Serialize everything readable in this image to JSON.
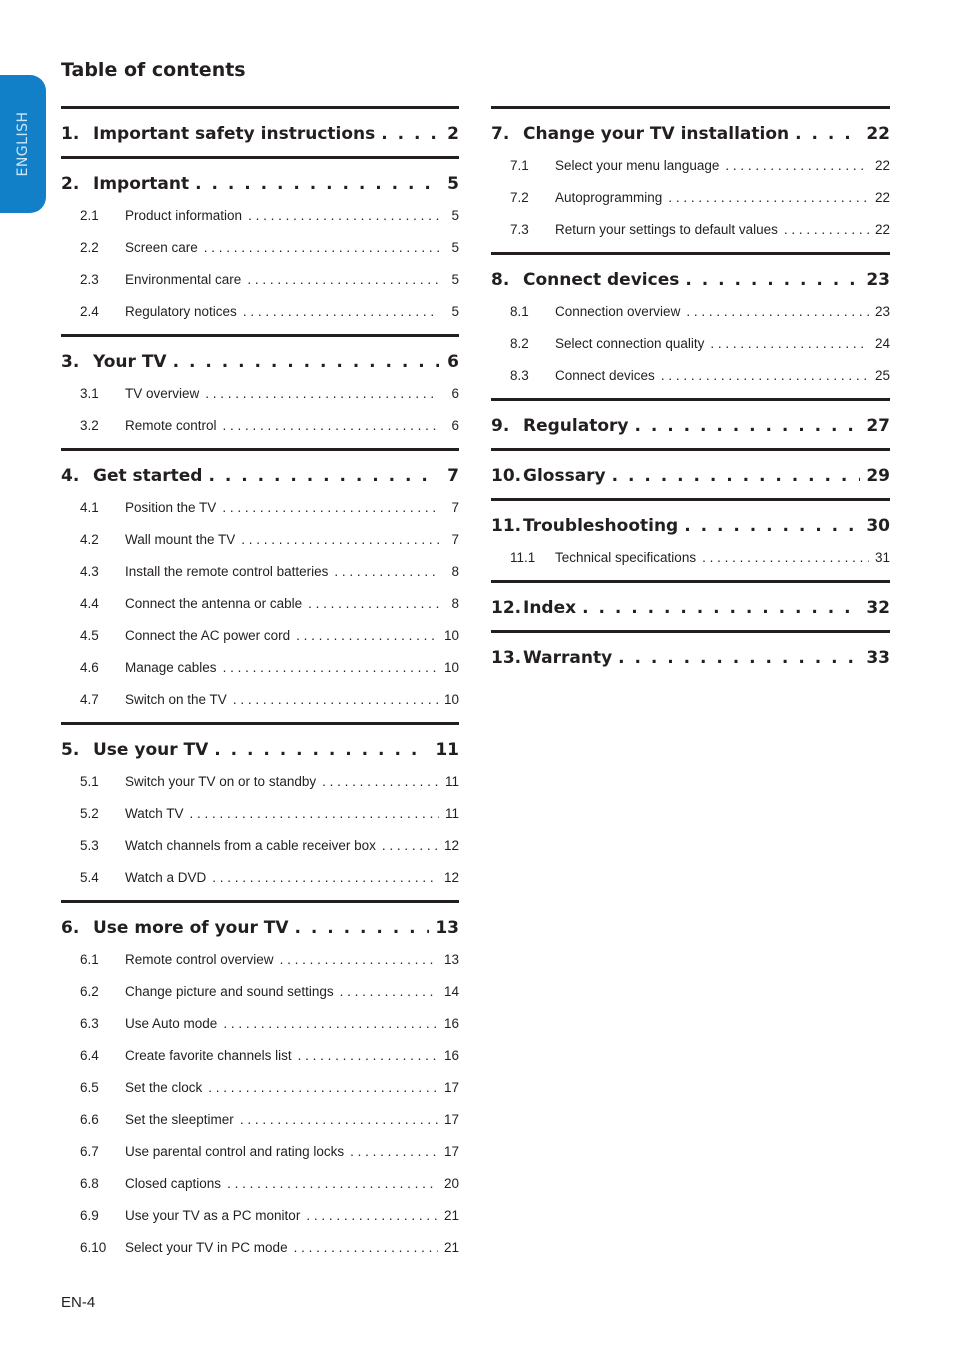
{
  "language_tab": "ENGLISH",
  "accent_color": "#1180c8",
  "title": "Table of contents",
  "columns": [
    [
      {
        "num": "1.",
        "title": "Important safety instructions",
        "page": "2",
        "subs": []
      },
      {
        "num": "2.",
        "title": "Important",
        "page": "5",
        "subs": [
          {
            "num": "2.1",
            "title": "Product information",
            "page": "5"
          },
          {
            "num": "2.2",
            "title": "Screen care",
            "page": "5"
          },
          {
            "num": "2.3",
            "title": "Environmental care",
            "page": "5"
          },
          {
            "num": "2.4",
            "title": "Regulatory notices",
            "page": "5"
          }
        ]
      },
      {
        "num": "3.",
        "title": "Your TV",
        "page": "6",
        "subs": [
          {
            "num": "3.1",
            "title": "TV overview",
            "page": "6"
          },
          {
            "num": "3.2",
            "title": "Remote control",
            "page": "6"
          }
        ]
      },
      {
        "num": "4.",
        "title": "Get started",
        "page": "7",
        "subs": [
          {
            "num": "4.1",
            "title": "Position the TV",
            "page": "7"
          },
          {
            "num": "4.2",
            "title": "Wall mount the TV",
            "page": "7"
          },
          {
            "num": "4.3",
            "title": "Install the remote control batteries",
            "page": "8"
          },
          {
            "num": "4.4",
            "title": "Connect the antenna or cable",
            "page": "8"
          },
          {
            "num": "4.5",
            "title": "Connect the AC power cord",
            "page": "10"
          },
          {
            "num": "4.6",
            "title": "Manage cables",
            "page": "10"
          },
          {
            "num": "4.7",
            "title": "Switch on the TV",
            "page": "10"
          }
        ]
      },
      {
        "num": "5.",
        "title": "Use your TV",
        "page": "11",
        "subs": [
          {
            "num": "5.1",
            "title": "Switch your TV on or to standby",
            "page": "11"
          },
          {
            "num": "5.2",
            "title": "Watch TV",
            "page": "11"
          },
          {
            "num": "5.3",
            "title": "Watch channels from a cable receiver box",
            "page": "12"
          },
          {
            "num": "5.4",
            "title": "Watch a DVD",
            "page": "12"
          }
        ]
      },
      {
        "num": "6.",
        "title": "Use more of your TV",
        "page": "13",
        "subs": [
          {
            "num": "6.1",
            "title": "Remote control overview",
            "page": "13"
          },
          {
            "num": "6.2",
            "title": "Change picture and sound settings",
            "page": "14"
          },
          {
            "num": "6.3",
            "title": "Use Auto mode",
            "page": "16"
          },
          {
            "num": "6.4",
            "title": "Create favorite channels list",
            "page": "16"
          },
          {
            "num": "6.5",
            "title": "Set the clock",
            "page": "17"
          },
          {
            "num": "6.6",
            "title": "Set the sleeptimer",
            "page": "17"
          },
          {
            "num": "6.7",
            "title": "Use parental control and rating locks",
            "page": "17"
          },
          {
            "num": "6.8",
            "title": "Closed captions",
            "page": "20"
          },
          {
            "num": "6.9",
            "title": "Use your TV as a PC monitor",
            "page": "21"
          },
          {
            "num": "6.10",
            "title": "Select your TV in PC mode",
            "page": "21"
          }
        ]
      }
    ],
    [
      {
        "num": "7.",
        "title": "Change your TV installation",
        "page": "22",
        "subs": [
          {
            "num": "7.1",
            "title": "Select your menu language",
            "page": "22"
          },
          {
            "num": "7.2",
            "title": "Autoprogramming",
            "page": "22"
          },
          {
            "num": "7.3",
            "title": "Return your settings to default values",
            "page": "22"
          }
        ]
      },
      {
        "num": "8.",
        "title": "Connect devices",
        "page": "23",
        "subs": [
          {
            "num": "8.1",
            "title": "Connection overview",
            "page": "23"
          },
          {
            "num": "8.2",
            "title": "Select connection quality",
            "page": "24"
          },
          {
            "num": "8.3",
            "title": "Connect devices",
            "page": "25"
          }
        ]
      },
      {
        "num": "9.",
        "title": "Regulatory",
        "page": "27",
        "subs": []
      },
      {
        "num": "10.",
        "title": "Glossary",
        "page": "29",
        "subs": []
      },
      {
        "num": "11.",
        "title": "Troubleshooting",
        "page": "30",
        "subs": [
          {
            "num": "11.1",
            "title": "Technical specifications",
            "page": "31"
          }
        ]
      },
      {
        "num": "12.",
        "title": "Index",
        "page": "32",
        "subs": []
      },
      {
        "num": "13.",
        "title": "Warranty",
        "page": "33",
        "subs": []
      }
    ]
  ],
  "footer": "EN-4"
}
